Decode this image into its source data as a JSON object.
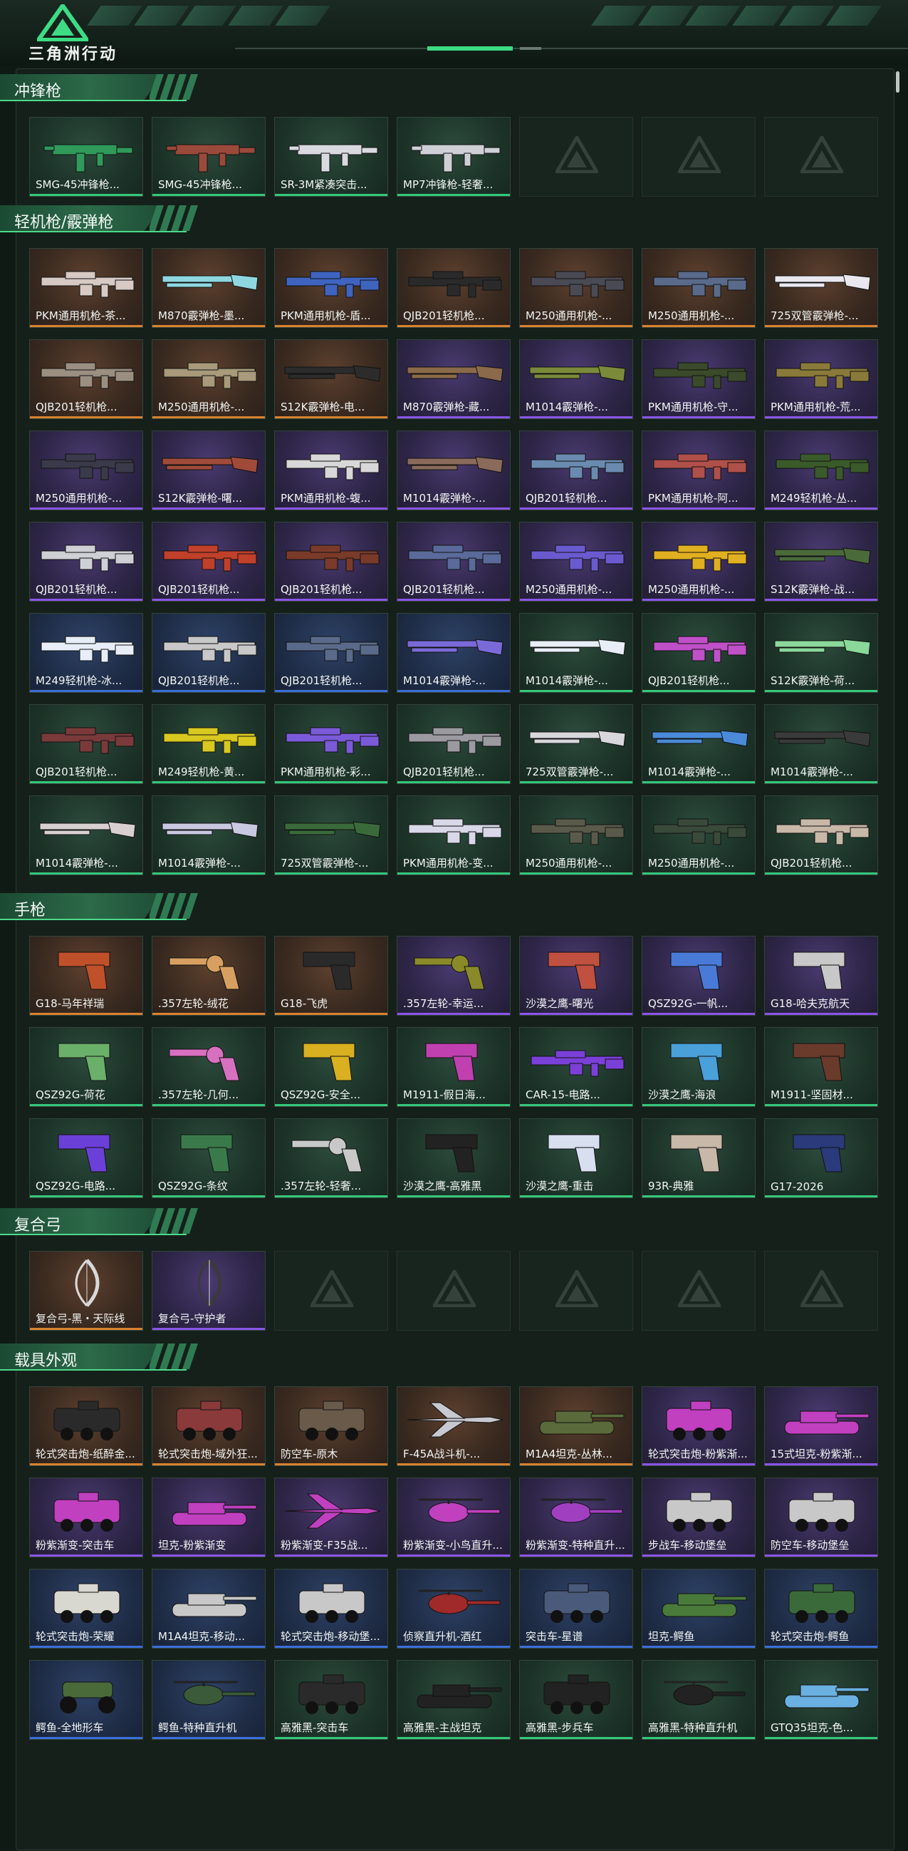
{
  "brand": {
    "logo_text": "三角洲行动",
    "accent": "#3ddc84"
  },
  "rarity_colors": {
    "gold": "#d8822e",
    "purple": "#8a55e8",
    "blue": "#3a6fd8",
    "green": "#35c77a"
  },
  "sections": [
    {
      "title": "冲锋枪",
      "cards": [
        {
          "label": "SMG-45冲锋枪...",
          "rarity": "green",
          "icon": "smg-icon",
          "color": "#2f9a5a"
        },
        {
          "label": "SMG-45冲锋枪...",
          "rarity": "green",
          "icon": "smg-icon",
          "color": "#9a4a3a"
        },
        {
          "label": "SR-3M紧凑突击...",
          "rarity": "green",
          "icon": "smg-icon",
          "color": "#d9d9e0"
        },
        {
          "label": "MP7冲锋枪-轻奢...",
          "rarity": "green",
          "icon": "smg-icon",
          "color": "#cfcfd6"
        },
        {
          "label": "",
          "rarity": "empty"
        },
        {
          "label": "",
          "rarity": "empty"
        },
        {
          "label": "",
          "rarity": "empty"
        }
      ]
    },
    {
      "title": "轻机枪/霰弹枪",
      "cards": [
        {
          "label": "PKM通用机枪-茶...",
          "rarity": "gold",
          "icon": "machine-gun-icon",
          "color": "#d7c9c4"
        },
        {
          "label": "M870霰弹枪-墨...",
          "rarity": "gold",
          "icon": "shotgun-icon",
          "color": "#8fd7e0"
        },
        {
          "label": "PKM通用机枪-盾...",
          "rarity": "gold",
          "icon": "machine-gun-icon",
          "color": "#3f64c0"
        },
        {
          "label": "QJB201轻机枪...",
          "rarity": "gold",
          "icon": "machine-gun-icon",
          "color": "#2a2a2a"
        },
        {
          "label": "M250通用机枪-...",
          "rarity": "gold",
          "icon": "machine-gun-icon",
          "color": "#4a4a55"
        },
        {
          "label": "M250通用机枪-...",
          "rarity": "gold",
          "icon": "machine-gun-icon",
          "color": "#5a6a8a"
        },
        {
          "label": "725双管霰弹枪-...",
          "rarity": "gold",
          "icon": "shotgun-icon",
          "color": "#e8e8ee"
        },
        {
          "label": "QJB201轻机枪...",
          "rarity": "gold",
          "icon": "machine-gun-icon",
          "color": "#9a8f80"
        },
        {
          "label": "M250通用机枪-...",
          "rarity": "gold",
          "icon": "machine-gun-icon",
          "color": "#a89a7a"
        },
        {
          "label": "S12K霰弹枪-电...",
          "rarity": "gold",
          "icon": "shotgun-icon",
          "color": "#2c2c2c"
        },
        {
          "label": "M870霰弹枪-藏...",
          "rarity": "purple",
          "icon": "shotgun-icon",
          "color": "#8a6a4a"
        },
        {
          "label": "M1014霰弹枪-...",
          "rarity": "purple",
          "icon": "shotgun-icon",
          "color": "#7a8a3a"
        },
        {
          "label": "PKM通用机枪-守...",
          "rarity": "purple",
          "icon": "machine-gun-icon",
          "color": "#3a4a2a"
        },
        {
          "label": "PKM通用机枪-荒...",
          "rarity": "purple",
          "icon": "machine-gun-icon",
          "color": "#8a7a3a"
        },
        {
          "label": "M250通用机枪-...",
          "rarity": "purple",
          "icon": "machine-gun-icon",
          "color": "#3a3a4a"
        },
        {
          "label": "S12K霰弹枪-曙...",
          "rarity": "purple",
          "icon": "shotgun-icon",
          "color": "#a04a3a"
        },
        {
          "label": "PKM通用机枪-蝮...",
          "rarity": "purple",
          "icon": "machine-gun-icon",
          "color": "#d8d8d8"
        },
        {
          "label": "M1014霰弹枪-...",
          "rarity": "purple",
          "icon": "shotgun-icon",
          "color": "#8a6a5a"
        },
        {
          "label": "QJB201轻机枪...",
          "rarity": "purple",
          "icon": "machine-gun-icon",
          "color": "#6a8ab0"
        },
        {
          "label": "PKM通用机枪-阿...",
          "rarity": "purple",
          "icon": "machine-gun-icon",
          "color": "#b0504a"
        },
        {
          "label": "M249轻机枪-丛...",
          "rarity": "purple",
          "icon": "machine-gun-icon",
          "color": "#3a5a2a"
        },
        {
          "label": "QJB201轻机枪...",
          "rarity": "purple",
          "icon": "machine-gun-icon",
          "color": "#cfcfd6"
        },
        {
          "label": "QJB201轻机枪...",
          "rarity": "purple",
          "icon": "machine-gun-icon",
          "color": "#c0402a"
        },
        {
          "label": "QJB201轻机枪...",
          "rarity": "purple",
          "icon": "machine-gun-icon",
          "color": "#7a3a2a"
        },
        {
          "label": "QJB201轻机枪...",
          "rarity": "purple",
          "icon": "machine-gun-icon",
          "color": "#5a6a9a"
        },
        {
          "label": "M250通用机枪-...",
          "rarity": "purple",
          "icon": "machine-gun-icon",
          "color": "#6a5ad0"
        },
        {
          "label": "M250通用机枪-...",
          "rarity": "purple",
          "icon": "machine-gun-icon",
          "color": "#e0b020"
        },
        {
          "label": "S12K霰弹枪-战...",
          "rarity": "purple",
          "icon": "shotgun-icon",
          "color": "#4a6a3a"
        },
        {
          "label": "M249轻机枪-冰...",
          "rarity": "blue",
          "icon": "machine-gun-icon",
          "color": "#e8eef8"
        },
        {
          "label": "QJB201轻机枪...",
          "rarity": "blue",
          "icon": "machine-gun-icon",
          "color": "#c8c8c8"
        },
        {
          "label": "QJB201轻机枪...",
          "rarity": "blue",
          "icon": "machine-gun-icon",
          "color": "#5a6a8a"
        },
        {
          "label": "M1014霰弹枪-...",
          "rarity": "blue",
          "icon": "shotgun-icon",
          "color": "#7a6ad8"
        },
        {
          "label": "M1014霰弹枪-...",
          "rarity": "green",
          "icon": "shotgun-icon",
          "color": "#e8eef6"
        },
        {
          "label": "QJB201轻机枪...",
          "rarity": "green",
          "icon": "machine-gun-icon",
          "color": "#c050c8"
        },
        {
          "label": "S12K霰弹枪-荷...",
          "rarity": "green",
          "icon": "shotgun-icon",
          "color": "#8ad89a"
        },
        {
          "label": "QJB201轻机枪...",
          "rarity": "green",
          "icon": "machine-gun-icon",
          "color": "#7a3a3a"
        },
        {
          "label": "M249轻机枪-黄...",
          "rarity": "green",
          "icon": "machine-gun-icon",
          "color": "#d8c820"
        },
        {
          "label": "PKM通用机枪-彩...",
          "rarity": "green",
          "icon": "machine-gun-icon",
          "color": "#7a5ad8"
        },
        {
          "label": "QJB201轻机枪...",
          "rarity": "green",
          "icon": "machine-gun-icon",
          "color": "#9a9aa0"
        },
        {
          "label": "725双管霰弹枪-...",
          "rarity": "green",
          "icon": "shotgun-icon",
          "color": "#d8d8dc"
        },
        {
          "label": "M1014霰弹枪-...",
          "rarity": "green",
          "icon": "shotgun-icon",
          "color": "#4a8ad8"
        },
        {
          "label": "M1014霰弹枪-...",
          "rarity": "green",
          "icon": "shotgun-icon",
          "color": "#3a3a3a"
        },
        {
          "label": "M1014霰弹枪-...",
          "rarity": "green",
          "icon": "shotgun-icon",
          "color": "#d8d0d0"
        },
        {
          "label": "M1014霰弹枪-...",
          "rarity": "green",
          "icon": "shotgun-icon",
          "color": "#c8c8e0"
        },
        {
          "label": "725双管霰弹枪-...",
          "rarity": "green",
          "icon": "shotgun-icon",
          "color": "#3a6a3a"
        },
        {
          "label": "PKM通用机枪-变...",
          "rarity": "green",
          "icon": "machine-gun-icon",
          "color": "#d8d8e8"
        },
        {
          "label": "M250通用机枪-...",
          "rarity": "green",
          "icon": "machine-gun-icon",
          "color": "#5a5a4a"
        },
        {
          "label": "M250通用机枪-...",
          "rarity": "green",
          "icon": "machine-gun-icon",
          "color": "#3a4a3a"
        },
        {
          "label": "QJB201轻机枪...",
          "rarity": "green",
          "icon": "machine-gun-icon",
          "color": "#c8b8a8"
        }
      ]
    },
    {
      "title": "手枪",
      "cards": [
        {
          "label": "G18-马年祥瑞",
          "rarity": "gold",
          "icon": "pistol-icon",
          "color": "#c0502a"
        },
        {
          "label": ".357左轮-绒花",
          "rarity": "gold",
          "icon": "revolver-icon",
          "color": "#d8a060"
        },
        {
          "label": "G18-飞虎",
          "rarity": "gold",
          "icon": "pistol-icon",
          "color": "#2a2a2a"
        },
        {
          "label": ".357左轮-幸运...",
          "rarity": "purple",
          "icon": "revolver-icon",
          "color": "#8a8a2a"
        },
        {
          "label": "沙漠之鹰-曙光",
          "rarity": "purple",
          "icon": "pistol-icon",
          "color": "#c05040"
        },
        {
          "label": "QSZ92G-一帆...",
          "rarity": "purple",
          "icon": "pistol-icon",
          "color": "#4a7ad8"
        },
        {
          "label": "G18-哈夫克航天",
          "rarity": "purple",
          "icon": "pistol-icon",
          "color": "#c8c8c8"
        },
        {
          "label": "QSZ92G-荷花",
          "rarity": "green",
          "icon": "pistol-icon",
          "color": "#6ab06a"
        },
        {
          "label": ".357左轮-几何...",
          "rarity": "green",
          "icon": "revolver-icon",
          "color": "#d870c0"
        },
        {
          "label": "QSZ92G-安全...",
          "rarity": "green",
          "icon": "pistol-icon",
          "color": "#d8b020"
        },
        {
          "label": "M1911-假日海...",
          "rarity": "green",
          "icon": "pistol-icon",
          "color": "#c040b0"
        },
        {
          "label": "CAR-15-电路...",
          "rarity": "green",
          "icon": "machine-gun-icon",
          "color": "#7a40d8"
        },
        {
          "label": "沙漠之鹰-海浪",
          "rarity": "green",
          "icon": "pistol-icon",
          "color": "#4aa0d8"
        },
        {
          "label": "M1911-坚固材...",
          "rarity": "green",
          "icon": "pistol-icon",
          "color": "#6a3a2a"
        },
        {
          "label": "QSZ92G-电路...",
          "rarity": "green",
          "icon": "pistol-icon",
          "color": "#6a40d8"
        },
        {
          "label": "QSZ92G-条纹",
          "rarity": "green",
          "icon": "pistol-icon",
          "color": "#3a7a4a"
        },
        {
          "label": ".357左轮-轻奢...",
          "rarity": "green",
          "icon": "revolver-icon",
          "color": "#c8c8c8"
        },
        {
          "label": "沙漠之鹰-高雅黑",
          "rarity": "green",
          "icon": "pistol-icon",
          "color": "#222"
        },
        {
          "label": "沙漠之鹰-重击",
          "rarity": "green",
          "icon": "pistol-icon",
          "color": "#d8e0f0"
        },
        {
          "label": "93R-典雅",
          "rarity": "green",
          "icon": "pistol-icon",
          "color": "#c8b8a8"
        },
        {
          "label": "G17-2026",
          "rarity": "green",
          "icon": "pistol-icon",
          "color": "#2a3a7a"
        }
      ]
    },
    {
      "title": "复合弓",
      "cards": [
        {
          "label": "复合弓-黑・天际线",
          "rarity": "gold",
          "icon": "bow-icon",
          "color": "#d8d8d8"
        },
        {
          "label": "复合弓-守护者",
          "rarity": "purple",
          "icon": "bow-icon",
          "color": "#3a3a3a"
        },
        {
          "label": "",
          "rarity": "empty"
        },
        {
          "label": "",
          "rarity": "empty"
        },
        {
          "label": "",
          "rarity": "empty"
        },
        {
          "label": "",
          "rarity": "empty"
        },
        {
          "label": "",
          "rarity": "empty"
        }
      ]
    },
    {
      "title": "载具外观",
      "cards": [
        {
          "label": "轮式突击炮-纸醉金...",
          "rarity": "gold",
          "icon": "armored-car-icon",
          "color": "#2a2a2a"
        },
        {
          "label": "轮式突击炮-域外狂...",
          "rarity": "gold",
          "icon": "armored-car-icon",
          "color": "#8a3a3a"
        },
        {
          "label": "防空车-原木",
          "rarity": "gold",
          "icon": "armored-car-icon",
          "color": "#6a5a4a"
        },
        {
          "label": "F-45A战斗机-...",
          "rarity": "gold",
          "icon": "jet-icon",
          "color": "#c8c8d0"
        },
        {
          "label": "M1A4坦克-丛林...",
          "rarity": "gold",
          "icon": "tank-icon",
          "color": "#5a6a3a"
        },
        {
          "label": "轮式突击炮-粉紫渐...",
          "rarity": "purple",
          "icon": "armored-car-icon",
          "color": "#c040c0"
        },
        {
          "label": "15式坦克-粉紫渐...",
          "rarity": "purple",
          "icon": "tank-icon",
          "color": "#c040c0"
        },
        {
          "label": "粉紫渐变-突击车",
          "rarity": "purple",
          "icon": "armored-car-icon",
          "color": "#c040c0"
        },
        {
          "label": "坦克-粉紫渐变",
          "rarity": "purple",
          "icon": "tank-icon",
          "color": "#c040c0"
        },
        {
          "label": "粉紫渐变-F35战...",
          "rarity": "purple",
          "icon": "jet-icon",
          "color": "#c040c0"
        },
        {
          "label": "粉紫渐变-小鸟直升...",
          "rarity": "purple",
          "icon": "helicopter-icon",
          "color": "#c040c0"
        },
        {
          "label": "粉紫渐变-特种直升...",
          "rarity": "purple",
          "icon": "helicopter-icon",
          "color": "#a040c0"
        },
        {
          "label": "步战车-移动堡垒",
          "rarity": "purple",
          "icon": "armored-car-icon",
          "color": "#c8c8c8"
        },
        {
          "label": "防空车-移动堡垒",
          "rarity": "purple",
          "icon": "armored-car-icon",
          "color": "#c8c8c8"
        },
        {
          "label": "轮式突击炮-荣耀",
          "rarity": "blue",
          "icon": "armored-car-icon",
          "color": "#d8d8d0"
        },
        {
          "label": "M1A4坦克-移动...",
          "rarity": "blue",
          "icon": "tank-icon",
          "color": "#c8c8c8"
        },
        {
          "label": "轮式突击炮-移动堡...",
          "rarity": "blue",
          "icon": "armored-car-icon",
          "color": "#c8c8c8"
        },
        {
          "label": "侦察直升机-酒红",
          "rarity": "blue",
          "icon": "helicopter-icon",
          "color": "#a02a2a"
        },
        {
          "label": "突击车-星谱",
          "rarity": "blue",
          "icon": "armored-car-icon",
          "color": "#4a5a7a"
        },
        {
          "label": "坦克-鳄鱼",
          "rarity": "blue",
          "icon": "tank-icon",
          "color": "#4a7a3a"
        },
        {
          "label": "轮式突击炮-鳄鱼",
          "rarity": "blue",
          "icon": "armored-car-icon",
          "color": "#3a6a3a"
        },
        {
          "label": "鳄鱼-全地形车",
          "rarity": "blue",
          "icon": "atv-icon",
          "color": "#4a6a3a"
        },
        {
          "label": "鳄鱼-特种直升机",
          "rarity": "blue",
          "icon": "helicopter-icon",
          "color": "#3a5a3a"
        },
        {
          "label": "高雅黑-突击车",
          "rarity": "green",
          "icon": "armored-car-icon",
          "color": "#2a2a2a"
        },
        {
          "label": "高雅黑-主战坦克",
          "rarity": "green",
          "icon": "tank-icon",
          "color": "#222"
        },
        {
          "label": "高雅黑-步兵车",
          "rarity": "green",
          "icon": "armored-car-icon",
          "color": "#222"
        },
        {
          "label": "高雅黑-特种直升机",
          "rarity": "green",
          "icon": "helicopter-icon",
          "color": "#222"
        },
        {
          "label": "GTQ35坦克-色...",
          "rarity": "green",
          "icon": "tank-icon",
          "color": "#6ab0e0"
        }
      ]
    }
  ]
}
